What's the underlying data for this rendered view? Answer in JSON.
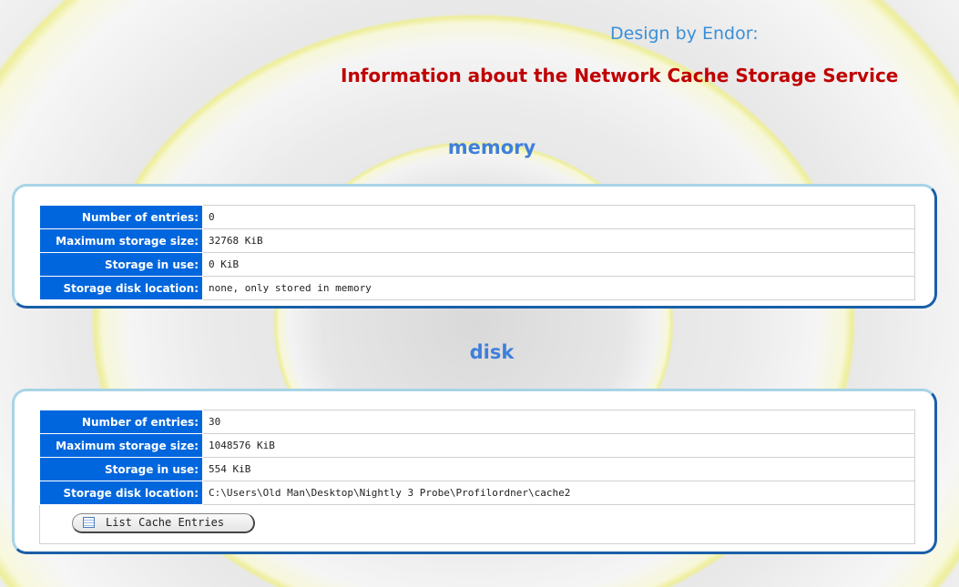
{
  "header": {
    "design_by": "Design by Endor:",
    "title": "Information about the Network Cache Storage Service"
  },
  "sections": [
    {
      "heading": "memory",
      "rows": [
        {
          "label": "Number of entries:",
          "value": "0"
        },
        {
          "label": "Maximum storage size:",
          "value": "32768 KiB"
        },
        {
          "label": "Storage in use:",
          "value": "0 KiB"
        },
        {
          "label": "Storage disk location:",
          "value": "none, only stored in memory"
        }
      ]
    },
    {
      "heading": "disk",
      "rows": [
        {
          "label": "Number of entries:",
          "value": "30"
        },
        {
          "label": "Maximum storage size:",
          "value": "1048576 KiB"
        },
        {
          "label": "Storage in use:",
          "value": "554 KiB"
        },
        {
          "label": "Storage disk location:",
          "value": "C:\\Users\\Old Man\\Desktop\\Nightly 3 Probe\\Profilordner\\cache2"
        }
      ],
      "button": {
        "label": "List Cache Entries",
        "icon": "list-icon"
      }
    }
  ],
  "colors": {
    "title": "#c00000",
    "design_by": "#3a8fd8",
    "heading": "#3f7fdb",
    "label_bg": "#0066dd"
  }
}
